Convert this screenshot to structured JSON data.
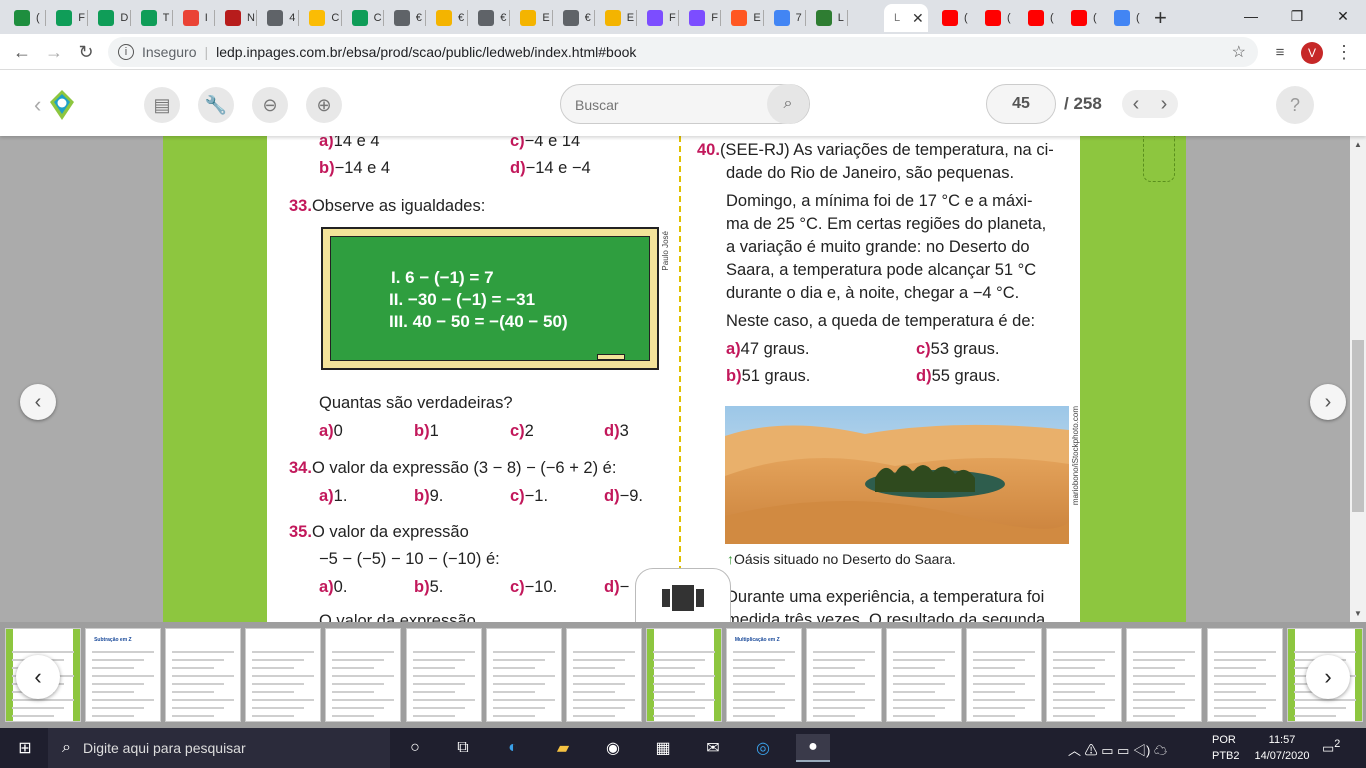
{
  "browser": {
    "tabs": [
      {
        "title": "(",
        "color": "#1e8e3e"
      },
      {
        "title": "F",
        "color": "#0f9d58"
      },
      {
        "title": "D",
        "color": "#0f9d58"
      },
      {
        "title": "T",
        "color": "#0f9d58"
      },
      {
        "title": "I",
        "color": "#ea4335"
      },
      {
        "title": "N",
        "color": "#b71c1c"
      },
      {
        "title": "4",
        "color": "#5f6368"
      },
      {
        "title": "C",
        "color": "#fbbc04"
      },
      {
        "title": "C",
        "color": "#0f9d58"
      },
      {
        "title": "€",
        "color": "#5f6368"
      },
      {
        "title": "€",
        "color": "#f4b400"
      },
      {
        "title": "€",
        "color": "#5f6368"
      },
      {
        "title": "E",
        "color": "#f4b400"
      },
      {
        "title": "€",
        "color": "#5f6368"
      },
      {
        "title": "E",
        "color": "#f4b400"
      },
      {
        "title": "F",
        "color": "#7c4dff"
      },
      {
        "title": "F",
        "color": "#7c4dff"
      },
      {
        "title": "E",
        "color": "#ff5722"
      },
      {
        "title": "7",
        "color": "#4285f4"
      },
      {
        "title": "L",
        "color": "#2e7d32"
      }
    ],
    "active_tab": {
      "title": "L"
    },
    "tail_tabs": [
      {
        "title": "(",
        "color": "#ff0000"
      },
      {
        "title": "(",
        "color": "#ff0000"
      },
      {
        "title": "(",
        "color": "#ff0000"
      },
      {
        "title": "(",
        "color": "#ff0000"
      },
      {
        "title": "(",
        "color": "#4285f4"
      }
    ],
    "new_tab": "+",
    "window": {
      "minimize": "—",
      "maximize": "❐",
      "close": "✕"
    },
    "security": "Inseguro",
    "url": "ledp.inpages.com.br/ebsa/prod/scao/public/ledweb/index.html#book",
    "profile_initial": "V"
  },
  "app": {
    "search_placeholder": "Buscar",
    "current_page": "45",
    "total_pages": "/ 258",
    "help": "?"
  },
  "left_col": {
    "q32_opts": [
      {
        "l": "a)",
        "t": "14 e 4"
      },
      {
        "l": "c)",
        "t": "−4 e 14"
      },
      {
        "l": "b)",
        "t": "−14 e 4"
      },
      {
        "l": "d)",
        "t": "−14 e −4"
      }
    ],
    "q33": {
      "num": "33.",
      "text": "Observe as igualdades:",
      "board": [
        "I. 6 − (−1) = 7",
        "II. −30 − (−1) = −31",
        "III. 40 − 50 = −(40 − 50)"
      ],
      "credit": "Paulo José",
      "question": "Quantas são verdadeiras?",
      "opts": [
        {
          "l": "a)",
          "t": "0"
        },
        {
          "l": "b)",
          "t": "1"
        },
        {
          "l": "c)",
          "t": "2"
        },
        {
          "l": "d)",
          "t": "3"
        }
      ]
    },
    "q34": {
      "num": "34.",
      "text": "O valor da expressão (3 − 8) − (−6 + 2) é:",
      "opts": [
        {
          "l": "a)",
          "t": "1."
        },
        {
          "l": "b)",
          "t": "9."
        },
        {
          "l": "c)",
          "t": "−1."
        },
        {
          "l": "d)",
          "t": "−9."
        }
      ]
    },
    "q35": {
      "num": "35.",
      "text": "O valor da expressão",
      "expr": "−5 − (−5) − 10 − (−10) é:",
      "opts": [
        {
          "l": "a)",
          "t": "0."
        },
        {
          "l": "b)",
          "t": "5."
        },
        {
          "l": "c)",
          "t": "−10."
        },
        {
          "l": "d)",
          "t": "−"
        }
      ]
    },
    "q36_partial": "O valor da expressão"
  },
  "right_col": {
    "q40": {
      "num": "40.",
      "lines": [
        "(SEE-RJ) As variações de temperatura, na ci-",
        "dade do Rio de Janeiro, são pequenas."
      ],
      "para": [
        "Domingo, a mínima foi de 17 °C e a máxi-",
        "ma de 25 °C. Em certas regiões do planeta,",
        "a variação é muito grande: no Deserto do",
        "Saara, a temperatura pode alcançar 51 °C",
        "durante o dia e, à noite, chegar a −4 °C."
      ],
      "question": "Neste caso, a queda de temperatura é de:",
      "opts": [
        {
          "l": "a)",
          "t": "47 graus."
        },
        {
          "l": "c)",
          "t": "53 graus."
        },
        {
          "l": "b)",
          "t": "51 graus."
        },
        {
          "l": "d)",
          "t": "55 graus."
        }
      ],
      "photo_credit": "mariobono/iStockphoto.com",
      "caption": "Oásis situado no Deserto do Saara."
    },
    "q41_partial": [
      "Durante uma experiência, a temperatura foi",
      "medida três vezes. O resultado da segunda"
    ]
  },
  "thumbs": [
    {
      "label": ""
    },
    {
      "label": "Subtração em Z"
    },
    {
      "label": ""
    },
    {
      "label": ""
    },
    {
      "label": ""
    },
    {
      "label": ""
    },
    {
      "label": ""
    },
    {
      "label": ""
    },
    {
      "label": ""
    },
    {
      "label": "Multiplicação em Z"
    },
    {
      "label": ""
    },
    {
      "label": ""
    },
    {
      "label": ""
    },
    {
      "label": ""
    },
    {
      "label": ""
    },
    {
      "label": ""
    },
    {
      "label": ""
    }
  ],
  "taskbar": {
    "search": "Digite aqui para pesquisar",
    "lang1": "POR",
    "lang2": "PTB2",
    "time": "11:57",
    "date": "14/07/2020",
    "notif": "2"
  }
}
